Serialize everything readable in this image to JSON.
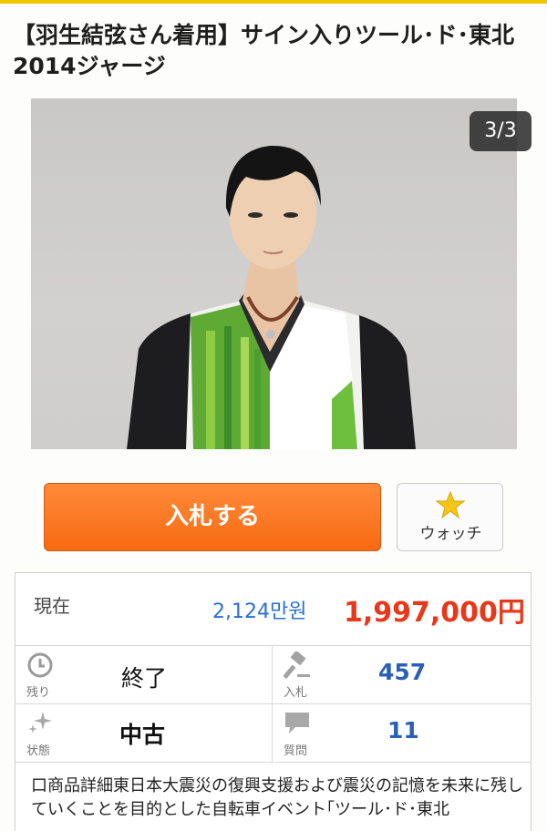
{
  "item": {
    "title": "【羽生結弦さん着用】サイン入りツール･ド･東北 2014ジャージ",
    "image_counter": "3/3"
  },
  "actions": {
    "bid_label": "入札する",
    "watch_label": "ウォッチ",
    "watch_icon": "star-icon"
  },
  "price": {
    "label": "現在",
    "krw": "2,124만원",
    "jpy": "1,997,000円"
  },
  "stats": {
    "remaining": {
      "small_label": "残り",
      "value": "終了",
      "icon": "clock-icon"
    },
    "bids": {
      "small_label": "入札",
      "value": "457",
      "icon": "gavel-icon"
    },
    "condition": {
      "small_label": "状態",
      "value": "中古",
      "icon": "sparkle-icon"
    },
    "questions": {
      "small_label": "質問",
      "value": "11",
      "icon": "speech-bubble-icon"
    }
  },
  "description": "口商品詳細東日本大震災の復興支援および震災の記憶を未来に残していくことを目的とした自転車イベント｢ツール･ド･東北",
  "colors": {
    "accent_orange": "#f76a12",
    "price_red": "#e8381a",
    "link_blue": "#2a6fd6",
    "top_bar": "#f2c400"
  }
}
